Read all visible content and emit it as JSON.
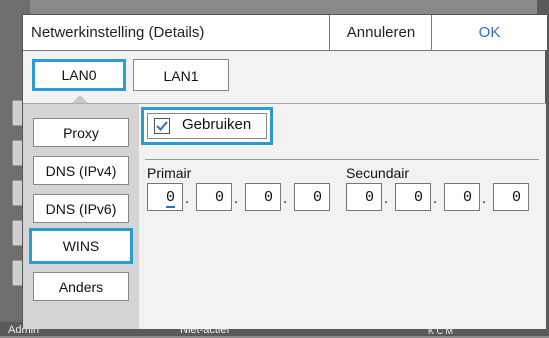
{
  "dialog": {
    "title": "Netwerkinstelling (Details)",
    "cancel_label": "Annuleren",
    "ok_label": "OK"
  },
  "tabs": [
    {
      "label": "LAN0",
      "selected": true
    },
    {
      "label": "LAN1",
      "selected": false
    }
  ],
  "sidebar": {
    "items": [
      {
        "label": "Proxy"
      },
      {
        "label": "DNS (IPv4)"
      },
      {
        "label": "DNS (IPv6)"
      },
      {
        "label": "WINS",
        "selected": true
      },
      {
        "label": "Anders"
      }
    ]
  },
  "wins": {
    "use_label": "Gebruiken",
    "use_checked": true,
    "primary_label": "Primair",
    "secondary_label": "Secundair",
    "primary": [
      "0",
      "0",
      "0",
      "0"
    ],
    "secondary": [
      "0",
      "0",
      "0",
      "0"
    ]
  },
  "statusbar": {
    "user": "Admin",
    "status": "Niet-actief",
    "ink": "K  C  M"
  },
  "colors": {
    "accent": "#2a9bd6",
    "ok_text": "#2a6fc9"
  }
}
